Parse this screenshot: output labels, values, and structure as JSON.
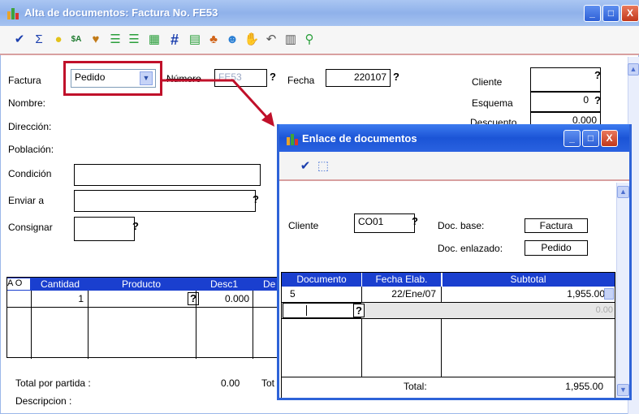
{
  "main": {
    "title": "Alta de documentos: Factura No. FE53",
    "controls": {
      "minimize": "_",
      "maximize": "□",
      "close": "X"
    },
    "toolbar_icons": [
      "check-icon",
      "sum-icon",
      "bulb-icon",
      "sign-icon",
      "handshake-icon",
      "list-icon",
      "list2-icon",
      "grid-icon",
      "hash-icon",
      "print-icon",
      "tree-icon",
      "people-icon",
      "hand-icon",
      "curve-icon",
      "calendar-icon",
      "search-icon"
    ],
    "form": {
      "factura_label": "Factura",
      "factura_value": "Pedido",
      "numero_label": "Número",
      "numero_value": "FE53",
      "fecha_label": "Fecha",
      "fecha_value": "220107",
      "cliente_label": "Cliente",
      "esquema_label": "Esquema",
      "esquema_value": "0",
      "descuento_label": "Descuento",
      "descuento_value": "0.000",
      "nombre_label": "Nombre:",
      "direccion_label": "Dirección:",
      "poblacion_label": "Población:",
      "condicion_label": "Condición",
      "enviar_label": "Enviar a",
      "consignar_label": "Consignar",
      "help": "?"
    },
    "table": {
      "headers": [
        "A O",
        "Cantidad",
        "Producto",
        "Desc1",
        "De"
      ],
      "row": {
        "cantidad": "1",
        "desc1": "0.000"
      }
    },
    "footer": {
      "total_partida_label": "Total por partida :",
      "total_partida_value": "0.00",
      "tot_label": "Tot",
      "descripcion_label": "Descripcion :"
    }
  },
  "dialog": {
    "title": "Enlace de documentos",
    "controls": {
      "minimize": "_",
      "maximize": "□",
      "close": "X"
    },
    "cliente_label": "Cliente",
    "cliente_value": "CO01",
    "doc_base_label": "Doc. base:",
    "doc_base_value": "Factura",
    "doc_enlazado_label": "Doc. enlazado:",
    "doc_enlazado_value": "Pedido",
    "help": "?",
    "table": {
      "headers": [
        "Documento",
        "Fecha Elab.",
        "Subtotal"
      ],
      "rows": [
        {
          "documento": "5",
          "fecha": "22/Ene/07",
          "subtotal": "1,955.00"
        },
        {
          "documento": "",
          "fecha": "",
          "subtotal": "0.00"
        }
      ],
      "total_label": "Total:",
      "total_value": "1,955.00"
    }
  },
  "colors": {
    "header_blue": "#1a3fcf",
    "annotation_red": "#c0102a",
    "title_blue": "#2e63d8"
  }
}
